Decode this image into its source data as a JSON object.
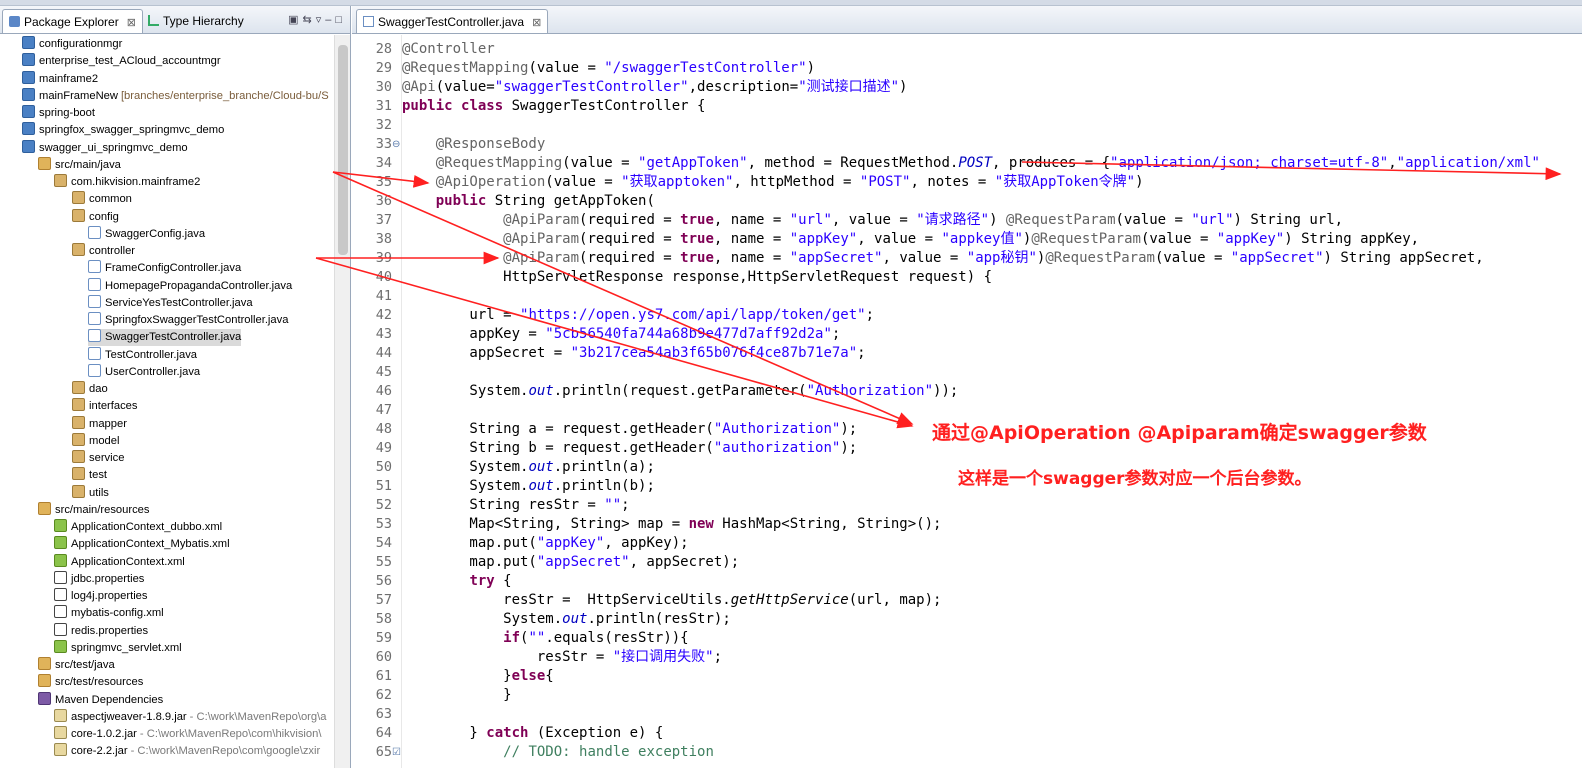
{
  "left_pane": {
    "tabs": [
      {
        "label": "Package Explorer",
        "close": "⊠"
      },
      {
        "label": "Type Hierarchy"
      }
    ],
    "tree": [
      {
        "label": "configurationmgr",
        "icon": "project-icon",
        "indent": 0,
        "extra": "",
        "extra_path": ""
      },
      {
        "label": "enterprise_test_ACloud_accountmgr",
        "icon": "project-icon",
        "indent": 0,
        "extra": "",
        "extra_path": ""
      },
      {
        "label": "mainframe2",
        "icon": "project-icon",
        "indent": 0,
        "extra": "",
        "extra_path": ""
      },
      {
        "label": "mainFrameNew",
        "icon": "project-icon",
        "indent": 0,
        "extra": "[branches/enterprise_branche/Cloud-bu/S",
        "extra_path": ""
      },
      {
        "label": "spring-boot",
        "icon": "project-icon",
        "indent": 0,
        "extra": "",
        "extra_path": ""
      },
      {
        "label": "springfox_swagger_springmvc_demo",
        "icon": "project-icon",
        "indent": 0,
        "extra": "",
        "extra_path": ""
      },
      {
        "label": "swagger_ui_springmvc_demo",
        "icon": "project-icon",
        "indent": 0,
        "extra": "",
        "extra_path": ""
      },
      {
        "label": "src/main/java",
        "icon": "source-folder-icon",
        "indent": 1,
        "extra": "",
        "extra_path": ""
      },
      {
        "label": "com.hikvision.mainframe2",
        "icon": "package-icon",
        "indent": 2,
        "extra": "",
        "extra_path": ""
      },
      {
        "label": "common",
        "icon": "package-icon",
        "indent": 3,
        "extra": "",
        "extra_path": ""
      },
      {
        "label": "config",
        "icon": "package-icon",
        "indent": 3,
        "extra": "",
        "extra_path": ""
      },
      {
        "label": "SwaggerConfig.java",
        "icon": "java-file-icon",
        "indent": 4,
        "extra": "",
        "extra_path": ""
      },
      {
        "label": "controller",
        "icon": "package-icon",
        "indent": 3,
        "extra": "",
        "extra_path": ""
      },
      {
        "label": "FrameConfigController.java",
        "icon": "java-file-icon",
        "indent": 4,
        "extra": "",
        "extra_path": ""
      },
      {
        "label": "HomepagePropagandaController.java",
        "icon": "java-file-icon",
        "indent": 4,
        "extra": "",
        "extra_path": ""
      },
      {
        "label": "ServiceYesTestController.java",
        "icon": "java-file-icon",
        "indent": 4,
        "extra": "",
        "extra_path": ""
      },
      {
        "label": "SpringfoxSwaggerTestController.java",
        "icon": "java-file-icon",
        "indent": 4,
        "extra": "",
        "extra_path": ""
      },
      {
        "label": "SwaggerTestController.java",
        "icon": "java-file-icon",
        "indent": 4,
        "extra": "",
        "extra_path": "",
        "selected": true
      },
      {
        "label": "TestController.java",
        "icon": "java-file-icon",
        "indent": 4,
        "extra": "",
        "extra_path": ""
      },
      {
        "label": "UserController.java",
        "icon": "java-file-icon",
        "indent": 4,
        "extra": "",
        "extra_path": ""
      },
      {
        "label": "dao",
        "icon": "package-icon",
        "indent": 3,
        "extra": "",
        "extra_path": ""
      },
      {
        "label": "interfaces",
        "icon": "package-icon",
        "indent": 3,
        "extra": "",
        "extra_path": ""
      },
      {
        "label": "mapper",
        "icon": "package-icon",
        "indent": 3,
        "extra": "",
        "extra_path": ""
      },
      {
        "label": "model",
        "icon": "package-icon",
        "indent": 3,
        "extra": "",
        "extra_path": ""
      },
      {
        "label": "service",
        "icon": "package-icon",
        "indent": 3,
        "extra": "",
        "extra_path": ""
      },
      {
        "label": "test",
        "icon": "package-icon",
        "indent": 3,
        "extra": "",
        "extra_path": ""
      },
      {
        "label": "utils",
        "icon": "package-icon",
        "indent": 3,
        "extra": "",
        "extra_path": ""
      },
      {
        "label": "src/main/resources",
        "icon": "source-folder-icon",
        "indent": 1,
        "extra": "",
        "extra_path": ""
      },
      {
        "label": "ApplicationContext_dubbo.xml",
        "icon": "spring-xml-icon",
        "indent": 2,
        "extra": "",
        "extra_path": ""
      },
      {
        "label": "ApplicationContext_Mybatis.xml",
        "icon": "spring-xml-icon",
        "indent": 2,
        "extra": "",
        "extra_path": ""
      },
      {
        "label": "ApplicationContext.xml",
        "icon": "spring-xml-icon",
        "indent": 2,
        "extra": "",
        "extra_path": ""
      },
      {
        "label": "jdbc.properties",
        "icon": "properties-file-icon",
        "indent": 2,
        "extra": "",
        "extra_path": ""
      },
      {
        "label": "log4j.properties",
        "icon": "properties-file-icon",
        "indent": 2,
        "extra": "",
        "extra_path": ""
      },
      {
        "label": "mybatis-config.xml",
        "icon": "properties-file-icon",
        "indent": 2,
        "extra": "",
        "extra_path": ""
      },
      {
        "label": "redis.properties",
        "icon": "properties-file-icon",
        "indent": 2,
        "extra": "",
        "extra_path": ""
      },
      {
        "label": "springmvc_servlet.xml",
        "icon": "spring-xml-icon",
        "indent": 2,
        "extra": "",
        "extra_path": ""
      },
      {
        "label": "src/test/java",
        "icon": "source-folder-icon",
        "indent": 1,
        "extra": "",
        "extra_path": ""
      },
      {
        "label": "src/test/resources",
        "icon": "source-folder-icon",
        "indent": 1,
        "extra": "",
        "extra_path": ""
      },
      {
        "label": "Maven Dependencies",
        "icon": "maven-icon",
        "indent": 1,
        "extra": "",
        "extra_path": ""
      },
      {
        "label": "aspectjweaver-1.8.9.jar",
        "icon": "jar-icon",
        "indent": 2,
        "extra": "",
        "extra_path": "- C:\\work\\MavenRepo\\org\\a"
      },
      {
        "label": "core-1.0.2.jar",
        "icon": "jar-icon",
        "indent": 2,
        "extra": "",
        "extra_path": "- C:\\work\\MavenRepo\\com\\hikvision\\"
      },
      {
        "label": "core-2.2.jar",
        "icon": "jar-icon",
        "indent": 2,
        "extra": "",
        "extra_path": "- C:\\work\\MavenRepo\\com\\google\\zxir"
      }
    ]
  },
  "editor": {
    "tab": {
      "label": "SwaggerTestController.java",
      "close": "⊠"
    },
    "lines": [
      {
        "n": "28",
        "code": [
          [
            "an",
            "@Controller"
          ]
        ]
      },
      {
        "n": "29",
        "code": [
          [
            "an",
            "@RequestMapping"
          ],
          [
            "",
            "(value = "
          ],
          [
            "st",
            "\"/swaggerTestController\""
          ],
          [
            "",
            ")"
          ]
        ]
      },
      {
        "n": "30",
        "code": [
          [
            "an",
            "@Api"
          ],
          [
            "",
            "(value="
          ],
          [
            "st",
            "\"swaggerTestController\""
          ],
          [
            "",
            ",description="
          ],
          [
            "st",
            "\"测试接口描述\""
          ],
          [
            "",
            ")"
          ]
        ]
      },
      {
        "n": "31",
        "code": [
          [
            "kw",
            "public"
          ],
          [
            "",
            " "
          ],
          [
            "kw",
            "class"
          ],
          [
            "",
            " SwaggerTestController {"
          ]
        ]
      },
      {
        "n": "32",
        "code": []
      },
      {
        "n": "33",
        "code": [
          [
            "",
            "    "
          ],
          [
            "an",
            "@ResponseBody"
          ]
        ],
        "marker": "⊖"
      },
      {
        "n": "34",
        "code": [
          [
            "",
            "    "
          ],
          [
            "an",
            "@RequestMapping"
          ],
          [
            "",
            "(value = "
          ],
          [
            "st",
            "\"getAppToken\""
          ],
          [
            "",
            ", method = RequestMethod."
          ],
          [
            "fd",
            "POST"
          ],
          [
            "",
            ", produces = {"
          ],
          [
            "st",
            "\"application/json; charset=utf-8\""
          ],
          [
            "",
            ","
          ],
          [
            "st",
            "\"application/xml\""
          ]
        ]
      },
      {
        "n": "35",
        "code": [
          [
            "",
            "    "
          ],
          [
            "an",
            "@ApiOperation"
          ],
          [
            "",
            "(value = "
          ],
          [
            "st",
            "\"获取apptoken\""
          ],
          [
            "",
            ", httpMethod = "
          ],
          [
            "st",
            "\"POST\""
          ],
          [
            "",
            ", notes = "
          ],
          [
            "st",
            "\"获取AppToken令牌\""
          ],
          [
            "",
            ")"
          ]
        ]
      },
      {
        "n": "36",
        "code": [
          [
            "",
            "    "
          ],
          [
            "kw",
            "public"
          ],
          [
            "",
            " String getAppToken("
          ]
        ]
      },
      {
        "n": "37",
        "code": [
          [
            "",
            "            "
          ],
          [
            "an",
            "@ApiParam"
          ],
          [
            "",
            "(required = "
          ],
          [
            "kw",
            "true"
          ],
          [
            "",
            ", name = "
          ],
          [
            "st",
            "\"url\""
          ],
          [
            "",
            ", value = "
          ],
          [
            "st",
            "\"请求路径\""
          ],
          [
            "",
            ") "
          ],
          [
            "an",
            "@RequestParam"
          ],
          [
            "",
            "(value = "
          ],
          [
            "st",
            "\"url\""
          ],
          [
            "",
            ") String url,"
          ]
        ]
      },
      {
        "n": "38",
        "code": [
          [
            "",
            "            "
          ],
          [
            "an",
            "@ApiParam"
          ],
          [
            "",
            "(required = "
          ],
          [
            "kw",
            "true"
          ],
          [
            "",
            ", name = "
          ],
          [
            "st",
            "\"appKey\""
          ],
          [
            "",
            ", value = "
          ],
          [
            "st",
            "\"appkey值\""
          ],
          [
            "",
            ")"
          ],
          [
            "an",
            "@RequestParam"
          ],
          [
            "",
            "(value = "
          ],
          [
            "st",
            "\"appKey\""
          ],
          [
            "",
            ") String appKey,"
          ]
        ]
      },
      {
        "n": "39",
        "code": [
          [
            "",
            "            "
          ],
          [
            "an",
            "@ApiParam"
          ],
          [
            "",
            "(required = "
          ],
          [
            "kw",
            "true"
          ],
          [
            "",
            ", name = "
          ],
          [
            "st",
            "\"appSecret\""
          ],
          [
            "",
            ", value = "
          ],
          [
            "st",
            "\"app秘钥\""
          ],
          [
            "",
            ")"
          ],
          [
            "an",
            "@RequestParam"
          ],
          [
            "",
            "(value = "
          ],
          [
            "st",
            "\"appSecret\""
          ],
          [
            "",
            ") String appSecret,"
          ]
        ]
      },
      {
        "n": "40",
        "code": [
          [
            "",
            "            HttpServletResponse response,HttpServletRequest request) {"
          ]
        ]
      },
      {
        "n": "41",
        "code": []
      },
      {
        "n": "42",
        "code": [
          [
            "",
            "        url = "
          ],
          [
            "st",
            "\"https://open.ys7.com/api/lapp/token/get\""
          ],
          [
            "",
            ";"
          ]
        ]
      },
      {
        "n": "43",
        "code": [
          [
            "",
            "        appKey = "
          ],
          [
            "st",
            "\"5cb56540fa744a68b9e477d7aff92d2a\""
          ],
          [
            "",
            ";"
          ]
        ]
      },
      {
        "n": "44",
        "code": [
          [
            "",
            "        appSecret = "
          ],
          [
            "st",
            "\"3b217cea54ab3f65b076f4ce87b71e7a\""
          ],
          [
            "",
            ";"
          ]
        ]
      },
      {
        "n": "45",
        "code": []
      },
      {
        "n": "46",
        "code": [
          [
            "",
            "        System."
          ],
          [
            "fd",
            "out"
          ],
          [
            "",
            ".println(request.getParameter("
          ],
          [
            "st",
            "\"Authorization\""
          ],
          [
            "",
            "));"
          ]
        ]
      },
      {
        "n": "47",
        "code": []
      },
      {
        "n": "48",
        "code": [
          [
            "",
            "        String a = request.getHeader("
          ],
          [
            "st",
            "\"Authorization\""
          ],
          [
            "",
            ");"
          ]
        ]
      },
      {
        "n": "49",
        "code": [
          [
            "",
            "        String b = request.getHeader("
          ],
          [
            "st",
            "\"authorization\""
          ],
          [
            "",
            ");"
          ]
        ]
      },
      {
        "n": "50",
        "code": [
          [
            "",
            "        System."
          ],
          [
            "fd",
            "out"
          ],
          [
            "",
            ".println(a);"
          ]
        ]
      },
      {
        "n": "51",
        "code": [
          [
            "",
            "        System."
          ],
          [
            "fd",
            "out"
          ],
          [
            "",
            ".println(b);"
          ]
        ]
      },
      {
        "n": "52",
        "code": [
          [
            "",
            "        String resStr = "
          ],
          [
            "st",
            "\"\""
          ],
          [
            "",
            ";"
          ]
        ]
      },
      {
        "n": "53",
        "code": [
          [
            "",
            "        Map<String, String> map = "
          ],
          [
            "kw",
            "new"
          ],
          [
            "",
            " HashMap<String, String>();"
          ]
        ]
      },
      {
        "n": "54",
        "code": [
          [
            "",
            "        map.put("
          ],
          [
            "st",
            "\"appKey\""
          ],
          [
            "",
            ", appKey);"
          ]
        ]
      },
      {
        "n": "55",
        "code": [
          [
            "",
            "        map.put("
          ],
          [
            "st",
            "\"appSecret\""
          ],
          [
            "",
            ", appSecret);"
          ]
        ]
      },
      {
        "n": "56",
        "code": [
          [
            "",
            "        "
          ],
          [
            "kw",
            "try"
          ],
          [
            "",
            " {"
          ]
        ]
      },
      {
        "n": "57",
        "code": [
          [
            "",
            "            resStr =  HttpServiceUtils."
          ],
          [
            "it",
            "getHttpService"
          ],
          [
            "",
            "(url, map);"
          ]
        ]
      },
      {
        "n": "58",
        "code": [
          [
            "",
            "            System."
          ],
          [
            "fd",
            "out"
          ],
          [
            "",
            ".println(resStr);"
          ]
        ]
      },
      {
        "n": "59",
        "code": [
          [
            "",
            "            "
          ],
          [
            "kw",
            "if"
          ],
          [
            "",
            "("
          ],
          [
            "st",
            "\"\""
          ],
          [
            "",
            ".equals(resStr)){"
          ]
        ]
      },
      {
        "n": "60",
        "code": [
          [
            "",
            "                resStr = "
          ],
          [
            "st",
            "\"接口调用失败\""
          ],
          [
            "",
            ";"
          ]
        ]
      },
      {
        "n": "61",
        "code": [
          [
            "",
            "            }"
          ],
          [
            "kw",
            "else"
          ],
          [
            "",
            "{"
          ]
        ]
      },
      {
        "n": "62",
        "code": [
          [
            "",
            "            }"
          ]
        ]
      },
      {
        "n": "63",
        "code": []
      },
      {
        "n": "64",
        "code": [
          [
            "",
            "        } "
          ],
          [
            "kw",
            "catch"
          ],
          [
            "",
            " (Exception e) {"
          ]
        ]
      },
      {
        "n": "65",
        "code": [
          [
            "",
            "            "
          ],
          [
            "cm",
            "// "
          ],
          [
            "cm",
            "TODO"
          ],
          [
            "cm",
            ": handle exception"
          ]
        ],
        "marker": "☑"
      }
    ]
  },
  "annotations": {
    "line1": "通过@ApiOperation @Apiparam确定swagger参数",
    "line2": "这样是一个swagger参数对应一个后台参数。"
  },
  "colors": {
    "keyword": "#7f0055",
    "annotation": "#646464",
    "string": "#2a00ff",
    "field": "#0000c0",
    "comment": "#3f7f5f",
    "arrow": "#ff2020"
  }
}
